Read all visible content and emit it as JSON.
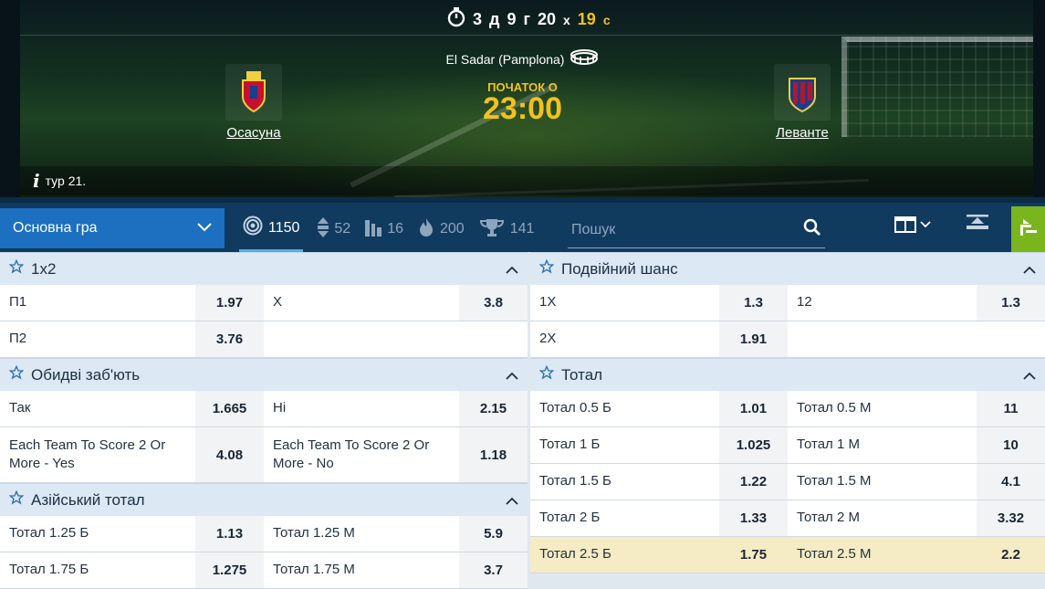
{
  "timer": {
    "d": "3",
    "d_unit": "д",
    "h": "9",
    "h_unit": "г",
    "m": "20",
    "m_unit": "х",
    "s": "19",
    "s_unit": "с"
  },
  "match": {
    "stadium": "El Sadar (Pamplona)",
    "start_label": "ПОЧАТОК О",
    "start_time": "23:00",
    "home_team": "Осасуна",
    "away_team": "Леванте",
    "round": "тур 21."
  },
  "toolbar": {
    "market_select": "Основна гра",
    "counts": [
      {
        "icon": "target-icon",
        "value": "1150"
      },
      {
        "icon": "updown-arrows-icon",
        "value": "52"
      },
      {
        "icon": "stats-bars-icon",
        "value": "16"
      },
      {
        "icon": "flame-icon",
        "value": "200"
      },
      {
        "icon": "trophy-icon",
        "value": "141"
      }
    ],
    "search_placeholder": "Пошук"
  },
  "markets": {
    "left": [
      {
        "title": "1x2",
        "rows": [
          [
            {
              "label": "П1",
              "odd": "1.97"
            },
            {
              "label": "X",
              "odd": "3.8"
            }
          ],
          [
            {
              "label": "П2",
              "odd": "3.76"
            },
            null
          ]
        ]
      },
      {
        "title": "Обидві заб'ють",
        "rows": [
          [
            {
              "label": "Так",
              "odd": "1.665"
            },
            {
              "label": "Ні",
              "odd": "2.15"
            }
          ],
          [
            {
              "label": "Each Team To Score 2 Or More - Yes",
              "odd": "4.08"
            },
            {
              "label": "Each Team To Score 2 Or More - No",
              "odd": "1.18"
            }
          ]
        ]
      },
      {
        "title": "Азійський тотал",
        "rows": [
          [
            {
              "label": "Тотал 1.25 Б",
              "odd": "1.13"
            },
            {
              "label": "Тотал 1.25 М",
              "odd": "5.9"
            }
          ],
          [
            {
              "label": "Тотал 1.75 Б",
              "odd": "1.275"
            },
            {
              "label": "Тотал 1.75 М",
              "odd": "3.7"
            }
          ]
        ]
      }
    ],
    "right": [
      {
        "title": "Подвійний шанс",
        "rows": [
          [
            {
              "label": "1X",
              "odd": "1.3"
            },
            {
              "label": "12",
              "odd": "1.3"
            }
          ],
          [
            {
              "label": "2X",
              "odd": "1.91"
            },
            null
          ]
        ]
      },
      {
        "title": "Тотал",
        "rows": [
          [
            {
              "label": "Тотал 0.5 Б",
              "odd": "1.01"
            },
            {
              "label": "Тотал 0.5 М",
              "odd": "11"
            }
          ],
          [
            {
              "label": "Тотал 1 Б",
              "odd": "1.025"
            },
            {
              "label": "Тотал 1 М",
              "odd": "10"
            }
          ],
          [
            {
              "label": "Тотал 1.5 Б",
              "odd": "1.22"
            },
            {
              "label": "Тотал 1.5 М",
              "odd": "4.1"
            }
          ],
          [
            {
              "label": "Тотал 2 Б",
              "odd": "1.33"
            },
            {
              "label": "Тотал 2 М",
              "odd": "3.32"
            }
          ],
          [
            {
              "label": "Тотал 2.5 Б",
              "odd": "1.75",
              "highlight": true
            },
            {
              "label": "Тотал 2.5 М",
              "odd": "2.2",
              "highlight": true
            }
          ]
        ]
      }
    ]
  },
  "colors": {
    "accent_yellow": "#f2c21b",
    "select_blue": "#1d6fbf",
    "toolbar_navy": "#113a5f",
    "green": "#7ab51d",
    "highlight": "#f5ebc4"
  }
}
